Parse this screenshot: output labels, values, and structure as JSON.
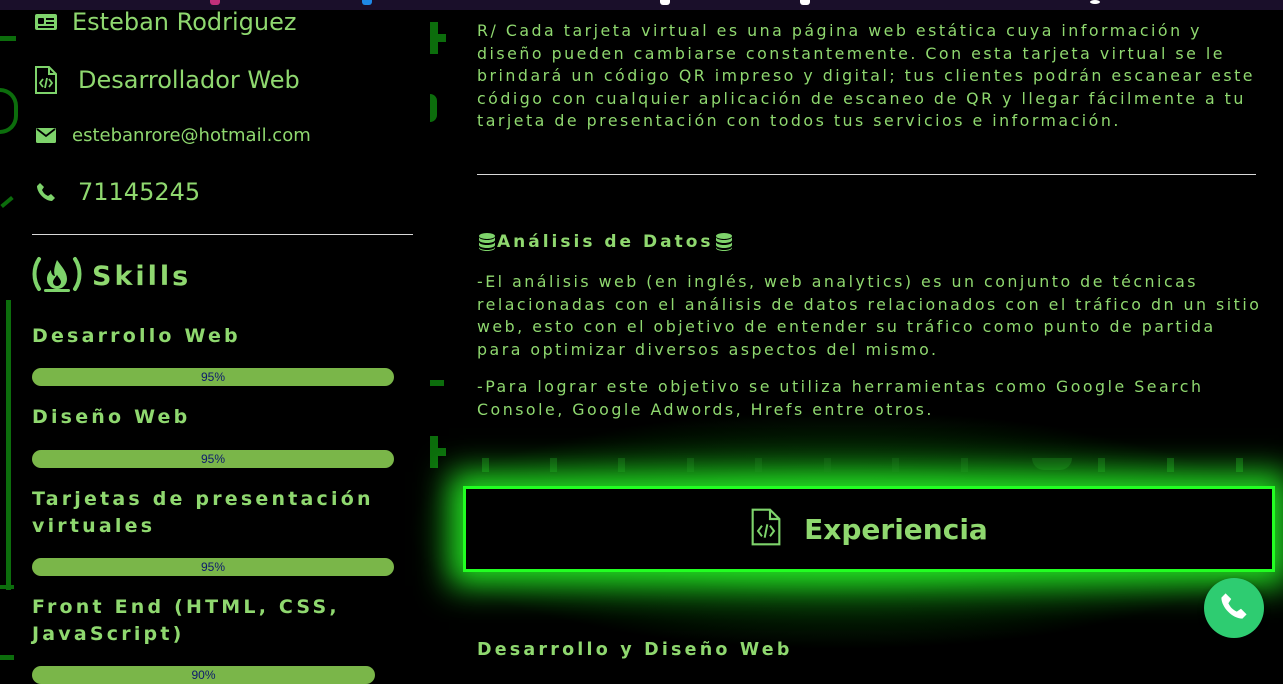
{
  "profile": {
    "name": "Esteban Rodriguez",
    "role": "Desarrollador Web",
    "email": "estebanrore@hotmail.com",
    "phone": "71145245"
  },
  "skills": {
    "title": "Skills",
    "items": [
      {
        "label": "Desarrollo Web",
        "percent": "95%",
        "value": 0.95
      },
      {
        "label": "Diseño Web",
        "percent": "95%",
        "value": 0.95
      },
      {
        "label": "Tarjetas de presentación virtuales",
        "percent": "95%",
        "value": 0.95
      },
      {
        "label": "Front End (HTML, CSS, JavaScript)",
        "percent": "90%",
        "value": 0.9
      }
    ]
  },
  "content": {
    "intro": "R/ Cada tarjeta virtual es una página web estática cuya información y diseño pueden cambiarse constantemente. Con esta tarjeta virtual se le brindará un código QR impreso y digital; tus clientes podrán escanear este código con cualquier aplicación de escaneo de QR y llegar fácilmente a tu tarjeta de presentación con todos tus servicios e información.",
    "analysis_title": "Análisis de Datos",
    "analysis_p1": "-El análisis web (en inglés, web analytics) es un conjunto de técnicas relacionadas con el análisis de datos relacionados con el tráfico dn un sitio web, esto con el objetivo de entender su tráfico como punto de partida para optimizar diversos aspectos del mismo.",
    "analysis_p2": "-Para lograr este objetivo se utiliza herramientas como Google Search Console, Google Adwords, Hrefs entre otros.",
    "experience_title": "Experiencia",
    "experience_sub": "Desarrollo y Diseño Web"
  },
  "icons": {
    "id_card": "id-card-icon",
    "file_code": "file-code-icon",
    "envelope": "envelope-icon",
    "phone": "phone-icon",
    "free_code_camp": "fire-icon",
    "database": "database-icon",
    "whatsapp": "whatsapp-icon"
  },
  "colors": {
    "accent_text": "#8fd86f",
    "bar": "#7ab649",
    "neon": "#22ff22",
    "fab": "#2ecc71",
    "background": "#000000"
  }
}
